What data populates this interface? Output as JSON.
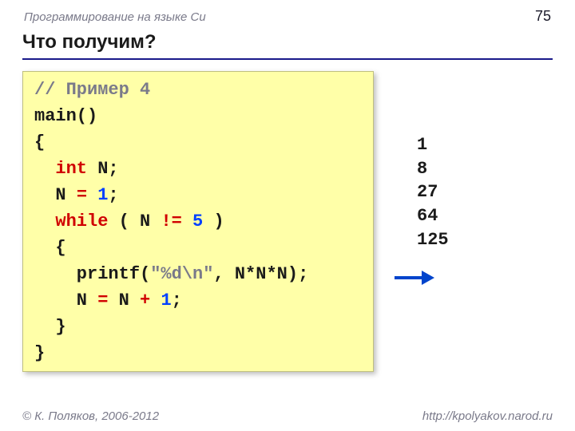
{
  "header": {
    "topic": "Программирование на языке Си",
    "page": "75"
  },
  "title": "Что получим?",
  "code": {
    "comment": "// Пример 4",
    "l2": "main()",
    "l3": "{",
    "kw_int": "int",
    "var_decl_rest": " N;",
    "l5a": "  N ",
    "eq1": "=",
    "sp": " ",
    "n1": "1",
    "semi": ";",
    "kw_while": "while",
    "while_open": " ( N ",
    "neq": "!=",
    "n5": "5",
    "while_close": " )",
    "l7": "  {",
    "printf_a": "    printf(",
    "str": "\"%d\\n\"",
    "printf_b": ", N*N*N);",
    "l9a": "    N ",
    "eq2": "=",
    "l9b": " N ",
    "plus": "+",
    "l10": "  }",
    "l11": "}"
  },
  "output_lines": [
    "1",
    "8",
    "27",
    "64",
    "125"
  ],
  "footer": {
    "left": "© К. Поляков, 2006-2012",
    "right": "http://kpolyakov.narod.ru"
  },
  "colors": {
    "accent_rule": "#1a1a8a",
    "code_bg": "#ffffa8",
    "keyword": "#d00000",
    "number": "#0040ff",
    "muted": "#7a7a8a",
    "arrow": "#0044cc"
  }
}
